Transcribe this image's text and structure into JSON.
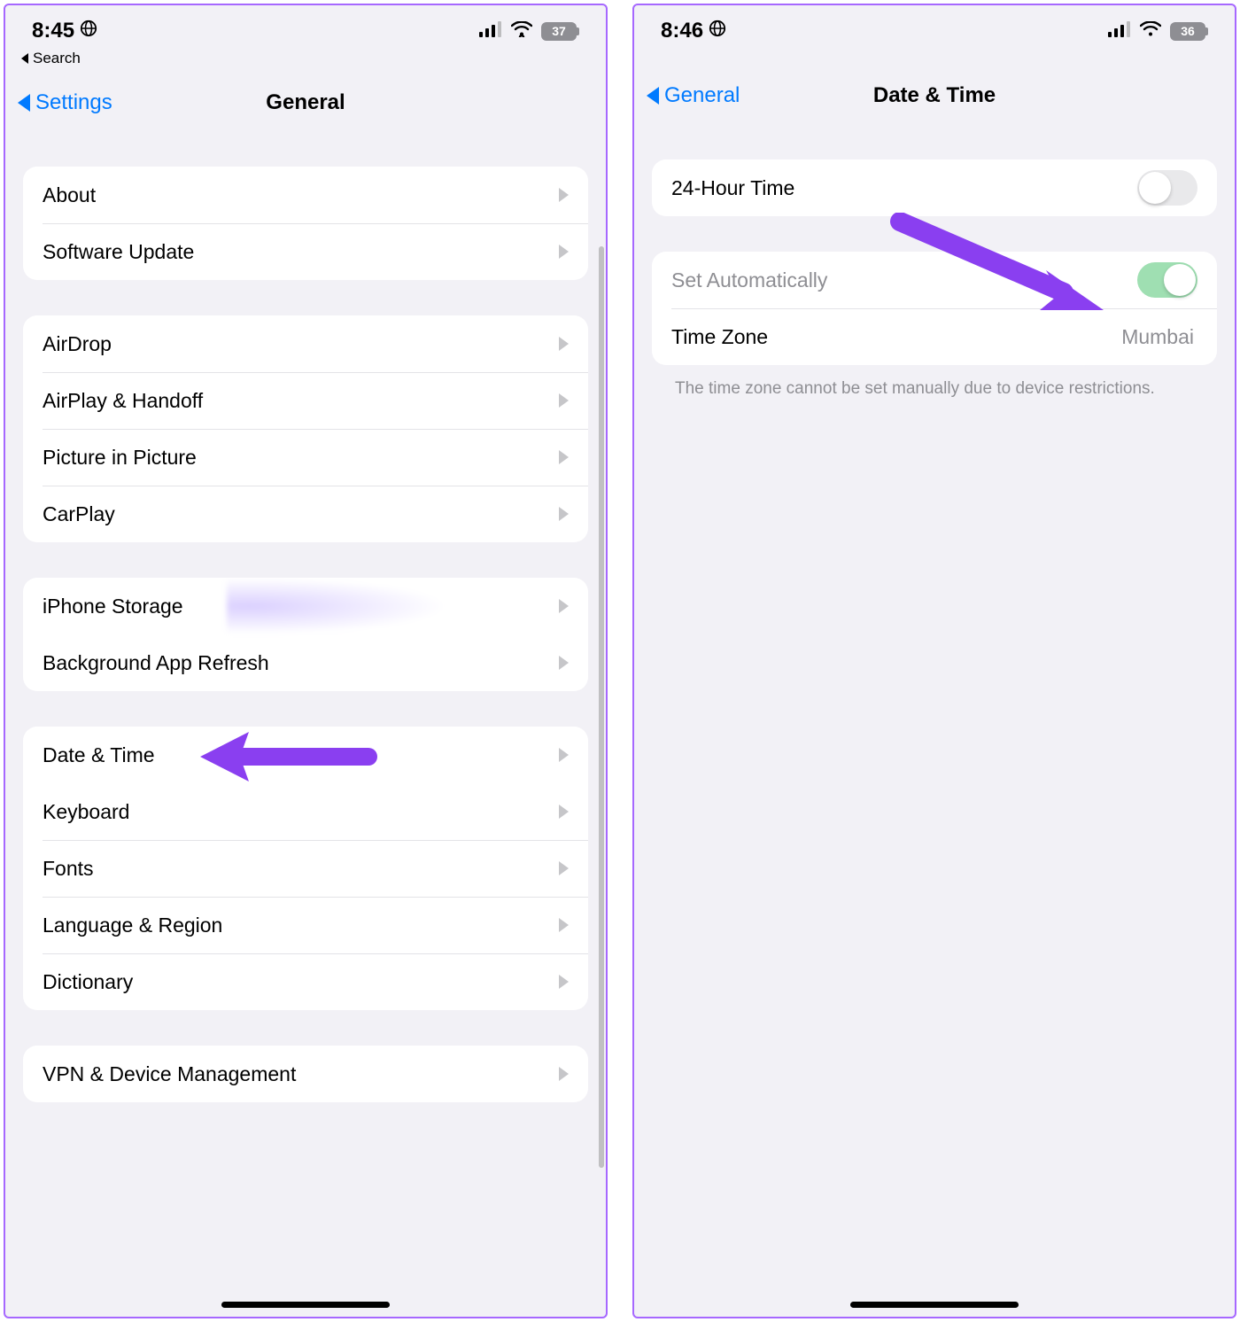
{
  "left": {
    "status_time": "8:45",
    "battery": "37",
    "breadcrumb": "Search",
    "nav_back": "Settings",
    "nav_title": "General",
    "groups": [
      {
        "rows": [
          {
            "label": "About"
          },
          {
            "label": "Software Update"
          }
        ]
      },
      {
        "rows": [
          {
            "label": "AirDrop"
          },
          {
            "label": "AirPlay & Handoff"
          },
          {
            "label": "Picture in Picture"
          },
          {
            "label": "CarPlay"
          }
        ]
      },
      {
        "rows": [
          {
            "label": "iPhone Storage"
          },
          {
            "label": "Background App Refresh"
          }
        ]
      },
      {
        "rows": [
          {
            "label": "Date & Time"
          },
          {
            "label": "Keyboard"
          },
          {
            "label": "Fonts"
          },
          {
            "label": "Language & Region"
          },
          {
            "label": "Dictionary"
          }
        ]
      },
      {
        "rows": [
          {
            "label": "VPN & Device Management"
          }
        ]
      }
    ]
  },
  "right": {
    "status_time": "8:46",
    "battery": "36",
    "nav_back": "General",
    "nav_title": "Date & Time",
    "row_24hour": "24-Hour Time",
    "row_set_auto": "Set Automatically",
    "row_timezone": "Time Zone",
    "timezone_value": "Mumbai",
    "footer": "The time zone cannot be set manually due to device restrictions."
  },
  "arrow_color": "#8a3ff0"
}
